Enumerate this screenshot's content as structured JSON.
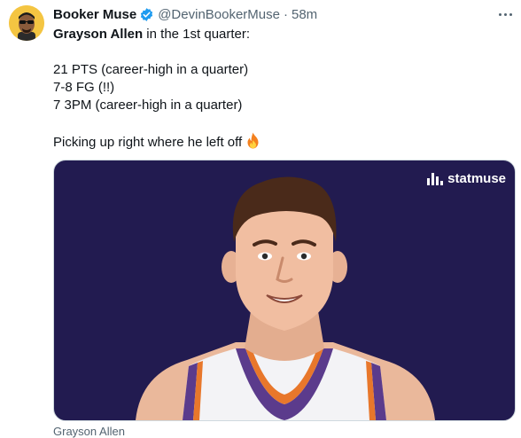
{
  "author": {
    "display_name": "Booker Muse",
    "handle": "@DevinBookerMuse",
    "separator": "·",
    "time": "58m",
    "verified_color": "#1d9bf0",
    "avatar_bg": "#f4c542"
  },
  "tweet": {
    "line1_bold": "Grayson Allen",
    "line1_rest": " in the 1st quarter:",
    "line2": "21 PTS (career-high in a quarter)",
    "line3": "7-8 FG (!!)",
    "line4": "7 3PM (career-high in a quarter)",
    "line5": "Picking up right where he left off",
    "line5_emoji": "fire-emoji"
  },
  "media": {
    "brand": "statmuse",
    "background": "#221b50",
    "caption": "Grayson Allen"
  },
  "icons": {
    "verified": "verified-badge-icon",
    "more": "more-options-icon",
    "brand_mark": "statmuse-logo-icon"
  }
}
